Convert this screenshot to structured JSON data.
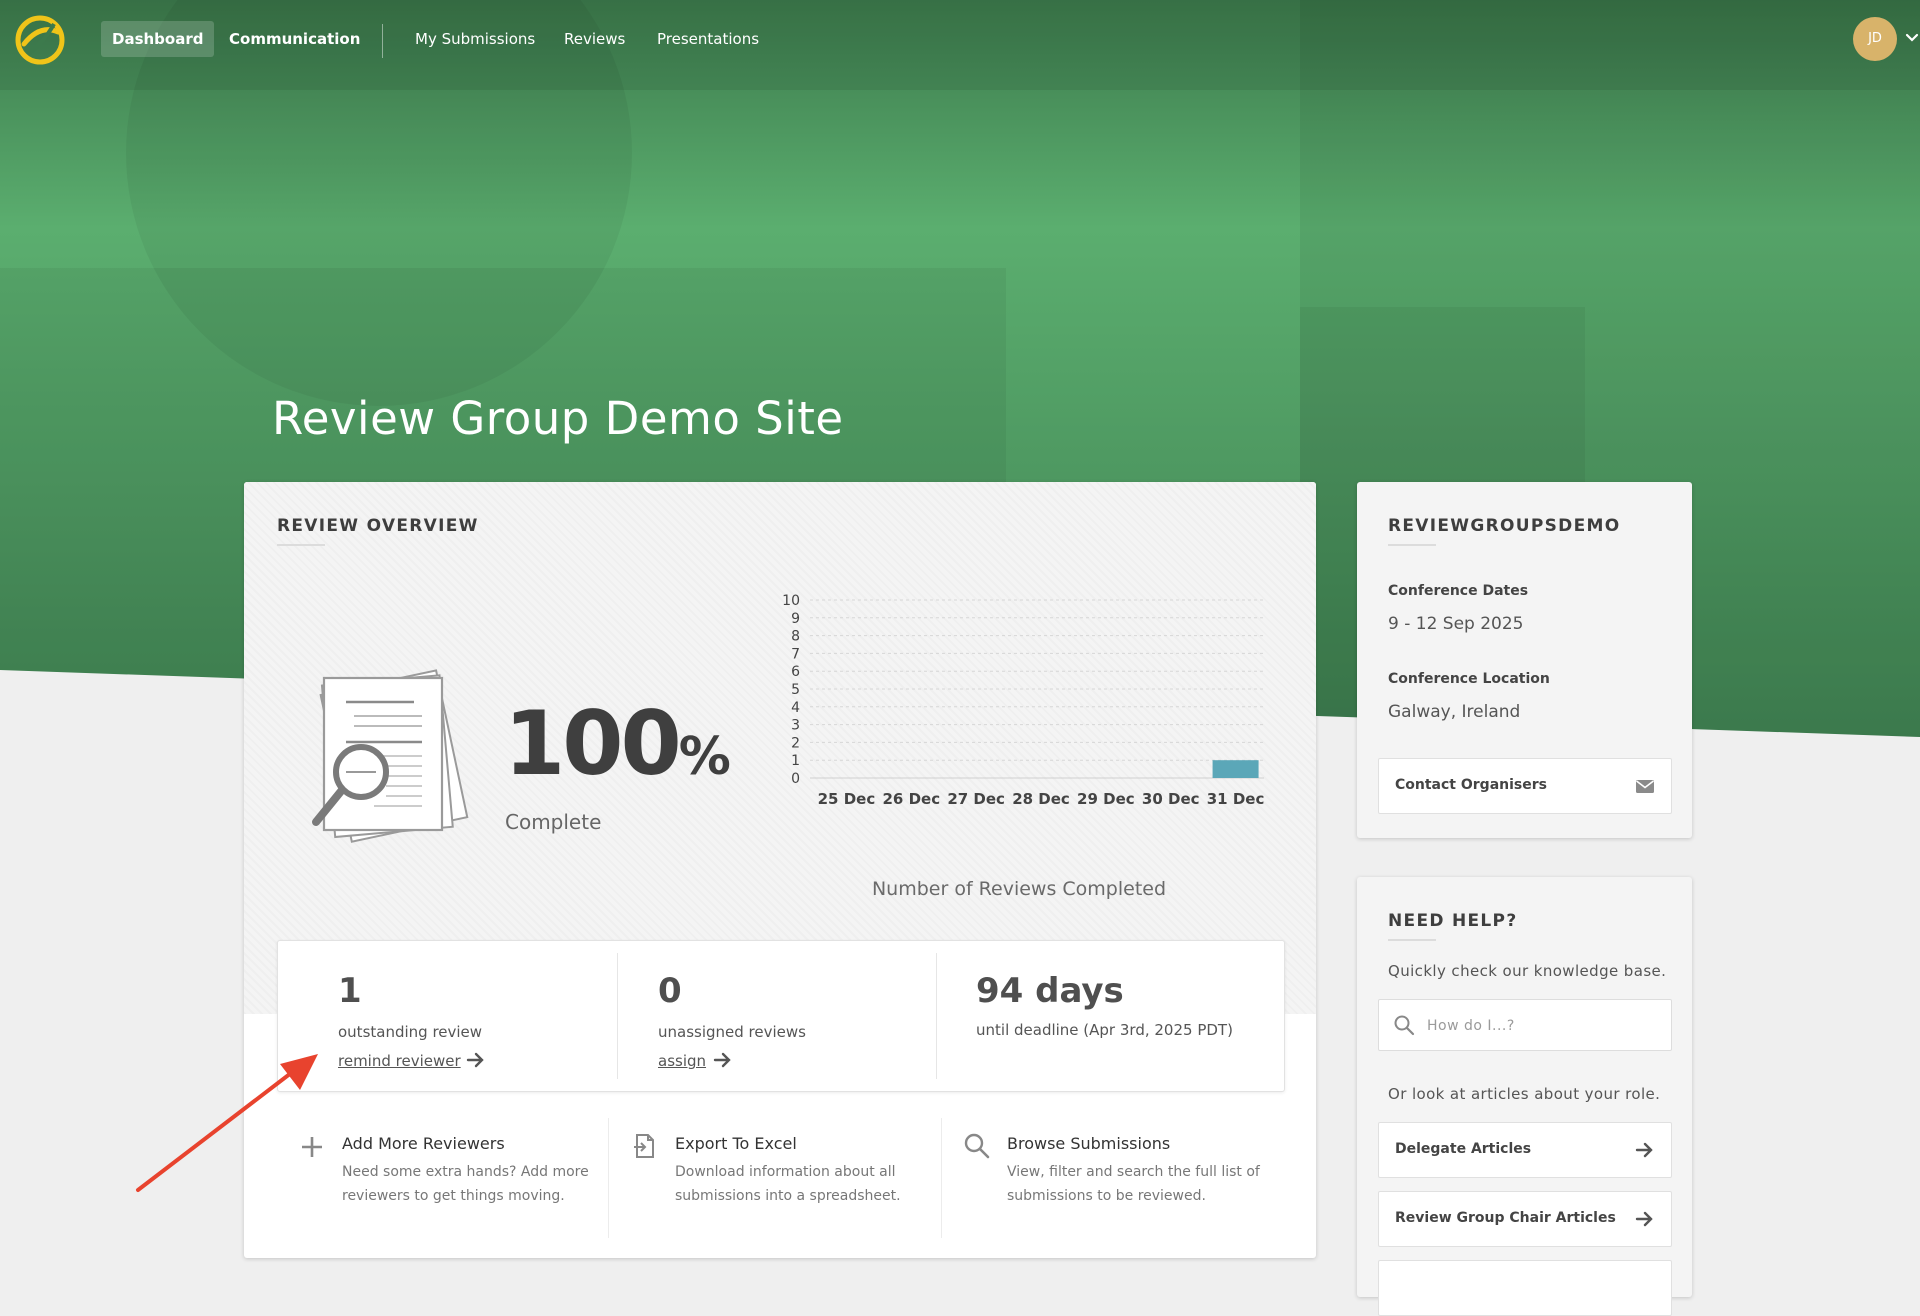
{
  "nav": {
    "items": [
      {
        "label": "Dashboard"
      },
      {
        "label": "Communication"
      },
      {
        "label": "My Submissions"
      },
      {
        "label": "Reviews"
      },
      {
        "label": "Presentations"
      }
    ],
    "avatar_initials": "JD"
  },
  "hero": {
    "title": "Review Group Demo Site"
  },
  "overview": {
    "title": "REVIEW OVERVIEW",
    "percent_value": "100",
    "percent_symbol": "%",
    "percent_label": "Complete",
    "chart_title": "Number of Reviews Completed"
  },
  "chart_data": {
    "type": "bar",
    "title": "Number of Reviews Completed",
    "categories": [
      "25 Dec",
      "26 Dec",
      "27 Dec",
      "28 Dec",
      "29 Dec",
      "30 Dec",
      "31 Dec"
    ],
    "values": [
      0,
      0,
      0,
      0,
      0,
      0,
      1
    ],
    "yticks": [
      "0",
      "1",
      "2",
      "3",
      "4",
      "5",
      "6",
      "7",
      "8",
      "9",
      "10"
    ],
    "ylim": [
      0,
      10
    ],
    "grid": true,
    "bar_color": "#5ba7b8"
  },
  "stats": [
    {
      "number": "1",
      "label": "outstanding review",
      "link": "remind reviewer"
    },
    {
      "number": "0",
      "label": "unassigned reviews",
      "link": "assign"
    },
    {
      "number": "94 days",
      "label": "until deadline (Apr 3rd, 2025 PDT)"
    }
  ],
  "actions": [
    {
      "icon": "plus-icon",
      "title": "Add More Reviewers",
      "desc": "Need some extra hands? Add more reviewers to get things moving."
    },
    {
      "icon": "export-file-icon",
      "title": "Export To Excel",
      "desc": "Download information about all submissions into a spreadsheet."
    },
    {
      "icon": "search-icon",
      "title": "Browse Submissions",
      "desc": "View, filter and search the full list of submissions to be reviewed."
    }
  ],
  "info": {
    "title": "REVIEWGROUPSDEMO",
    "dates_label": "Conference Dates",
    "dates_value": "9 - 12 Sep 2025",
    "location_label": "Conference Location",
    "location_value": "Galway, Ireland",
    "contact_label": "Contact Organisers"
  },
  "help": {
    "title": "NEED HELP?",
    "intro": "Quickly check our knowledge base.",
    "search_placeholder": "How do I...?",
    "articles_intro": "Or look at articles about your role.",
    "articles": [
      {
        "label": "Delegate Articles"
      },
      {
        "label": "Review Group Chair Articles"
      }
    ]
  },
  "colors": {
    "hero_green": "#5bae6f",
    "annotation_red": "#e8432e",
    "chart_bar": "#5ba7b8",
    "avatar": "#d8b36a"
  }
}
